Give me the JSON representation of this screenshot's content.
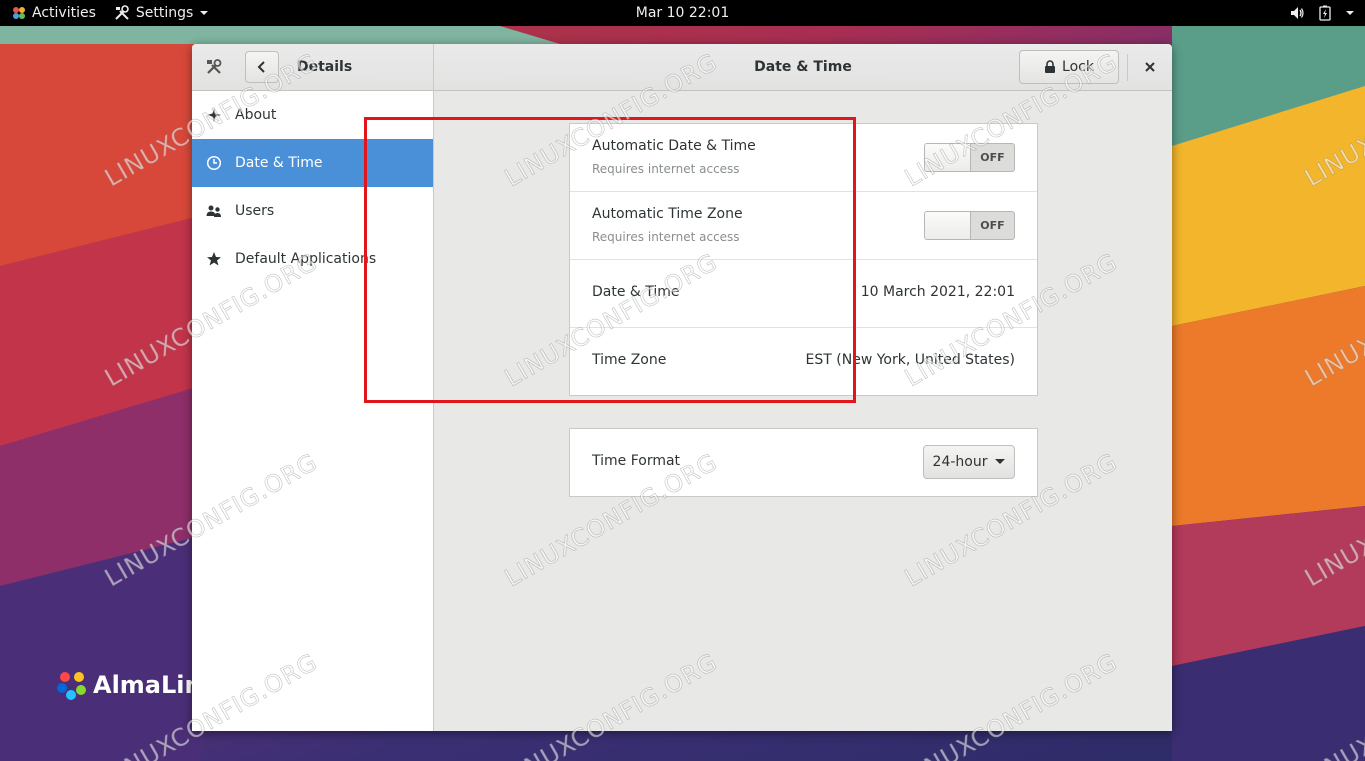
{
  "topbar": {
    "activities_label": "Activities",
    "app_menu_label": "Settings",
    "clock": "Mar 10  22:01"
  },
  "desktop": {
    "distro_name": "AlmaLin"
  },
  "window": {
    "sidebar_title": "Details",
    "title": "Date & Time",
    "lock_label": "Lock"
  },
  "sidebar": {
    "items": [
      {
        "label": "About",
        "icon": "sparkle-icon",
        "active": false
      },
      {
        "label": "Date & Time",
        "icon": "clock-icon",
        "active": true
      },
      {
        "label": "Users",
        "icon": "users-icon",
        "active": false
      },
      {
        "label": "Default Applications",
        "icon": "star-icon",
        "active": false
      }
    ]
  },
  "datetime": {
    "auto_datetime": {
      "title": "Automatic Date & Time",
      "subtitle": "Requires internet access",
      "state": "OFF"
    },
    "auto_timezone": {
      "title": "Automatic Time Zone",
      "subtitle": "Requires internet access",
      "state": "OFF"
    },
    "date_time": {
      "title": "Date & Time",
      "value": "10 March 2021, 22:01"
    },
    "time_zone": {
      "title": "Time Zone",
      "value": "EST (New York, United States)"
    },
    "time_format": {
      "title": "Time Format",
      "value": "24-hour"
    }
  },
  "watermark": "LINUXCONFIG.ORG",
  "colors": {
    "accent": "#4a90d9",
    "highlight": "#e0161c",
    "topbar": "#000000"
  }
}
